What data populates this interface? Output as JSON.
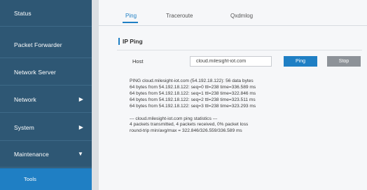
{
  "sidebar": {
    "items": [
      {
        "label": "Status"
      },
      {
        "label": "Packet Forwarder"
      },
      {
        "label": "Network Server"
      },
      {
        "label": "Network",
        "arrow": "chevron-right"
      },
      {
        "label": "System",
        "arrow": "chevron-right"
      },
      {
        "label": "Maintenance",
        "arrow": "chevron-down"
      }
    ],
    "sub_items": [
      {
        "label": "Tools"
      }
    ]
  },
  "tabs": [
    {
      "label": "Ping"
    },
    {
      "label": "Traceroute"
    },
    {
      "label": "Qxdmlog"
    }
  ],
  "section": {
    "title": "IP Ping"
  },
  "form": {
    "host_label": "Host",
    "host_value": "cloud.milesight-iot.com",
    "ping_label": "Ping",
    "stop_label": "Stop"
  },
  "output": {
    "lines": [
      "PING cloud.milesight-iot.com (54.192.18.122): 56 data bytes",
      "64 bytes from 54.192.18.122: seq=0 ttl=238 time=336.589 ms",
      "64 bytes from 54.192.18.122: seq=1 ttl=238 time=322.846 ms",
      "64 bytes from 54.192.18.122: seq=2 ttl=238 time=323.511 ms",
      "64 bytes from 54.192.18.122: seq=3 ttl=238 time=323.293 ms"
    ],
    "stats_lines": [
      "--- cloud.milesight-iot.com ping statistics ---",
      "4 packets transmitted, 4 packets received, 0% packet loss",
      "round-trip min/avg/max = 322.846/326.559/336.589 ms"
    ]
  },
  "colors": {
    "sidebar": "#2e5774",
    "accent": "#1f7fc4",
    "stop_button": "#8d9298"
  }
}
